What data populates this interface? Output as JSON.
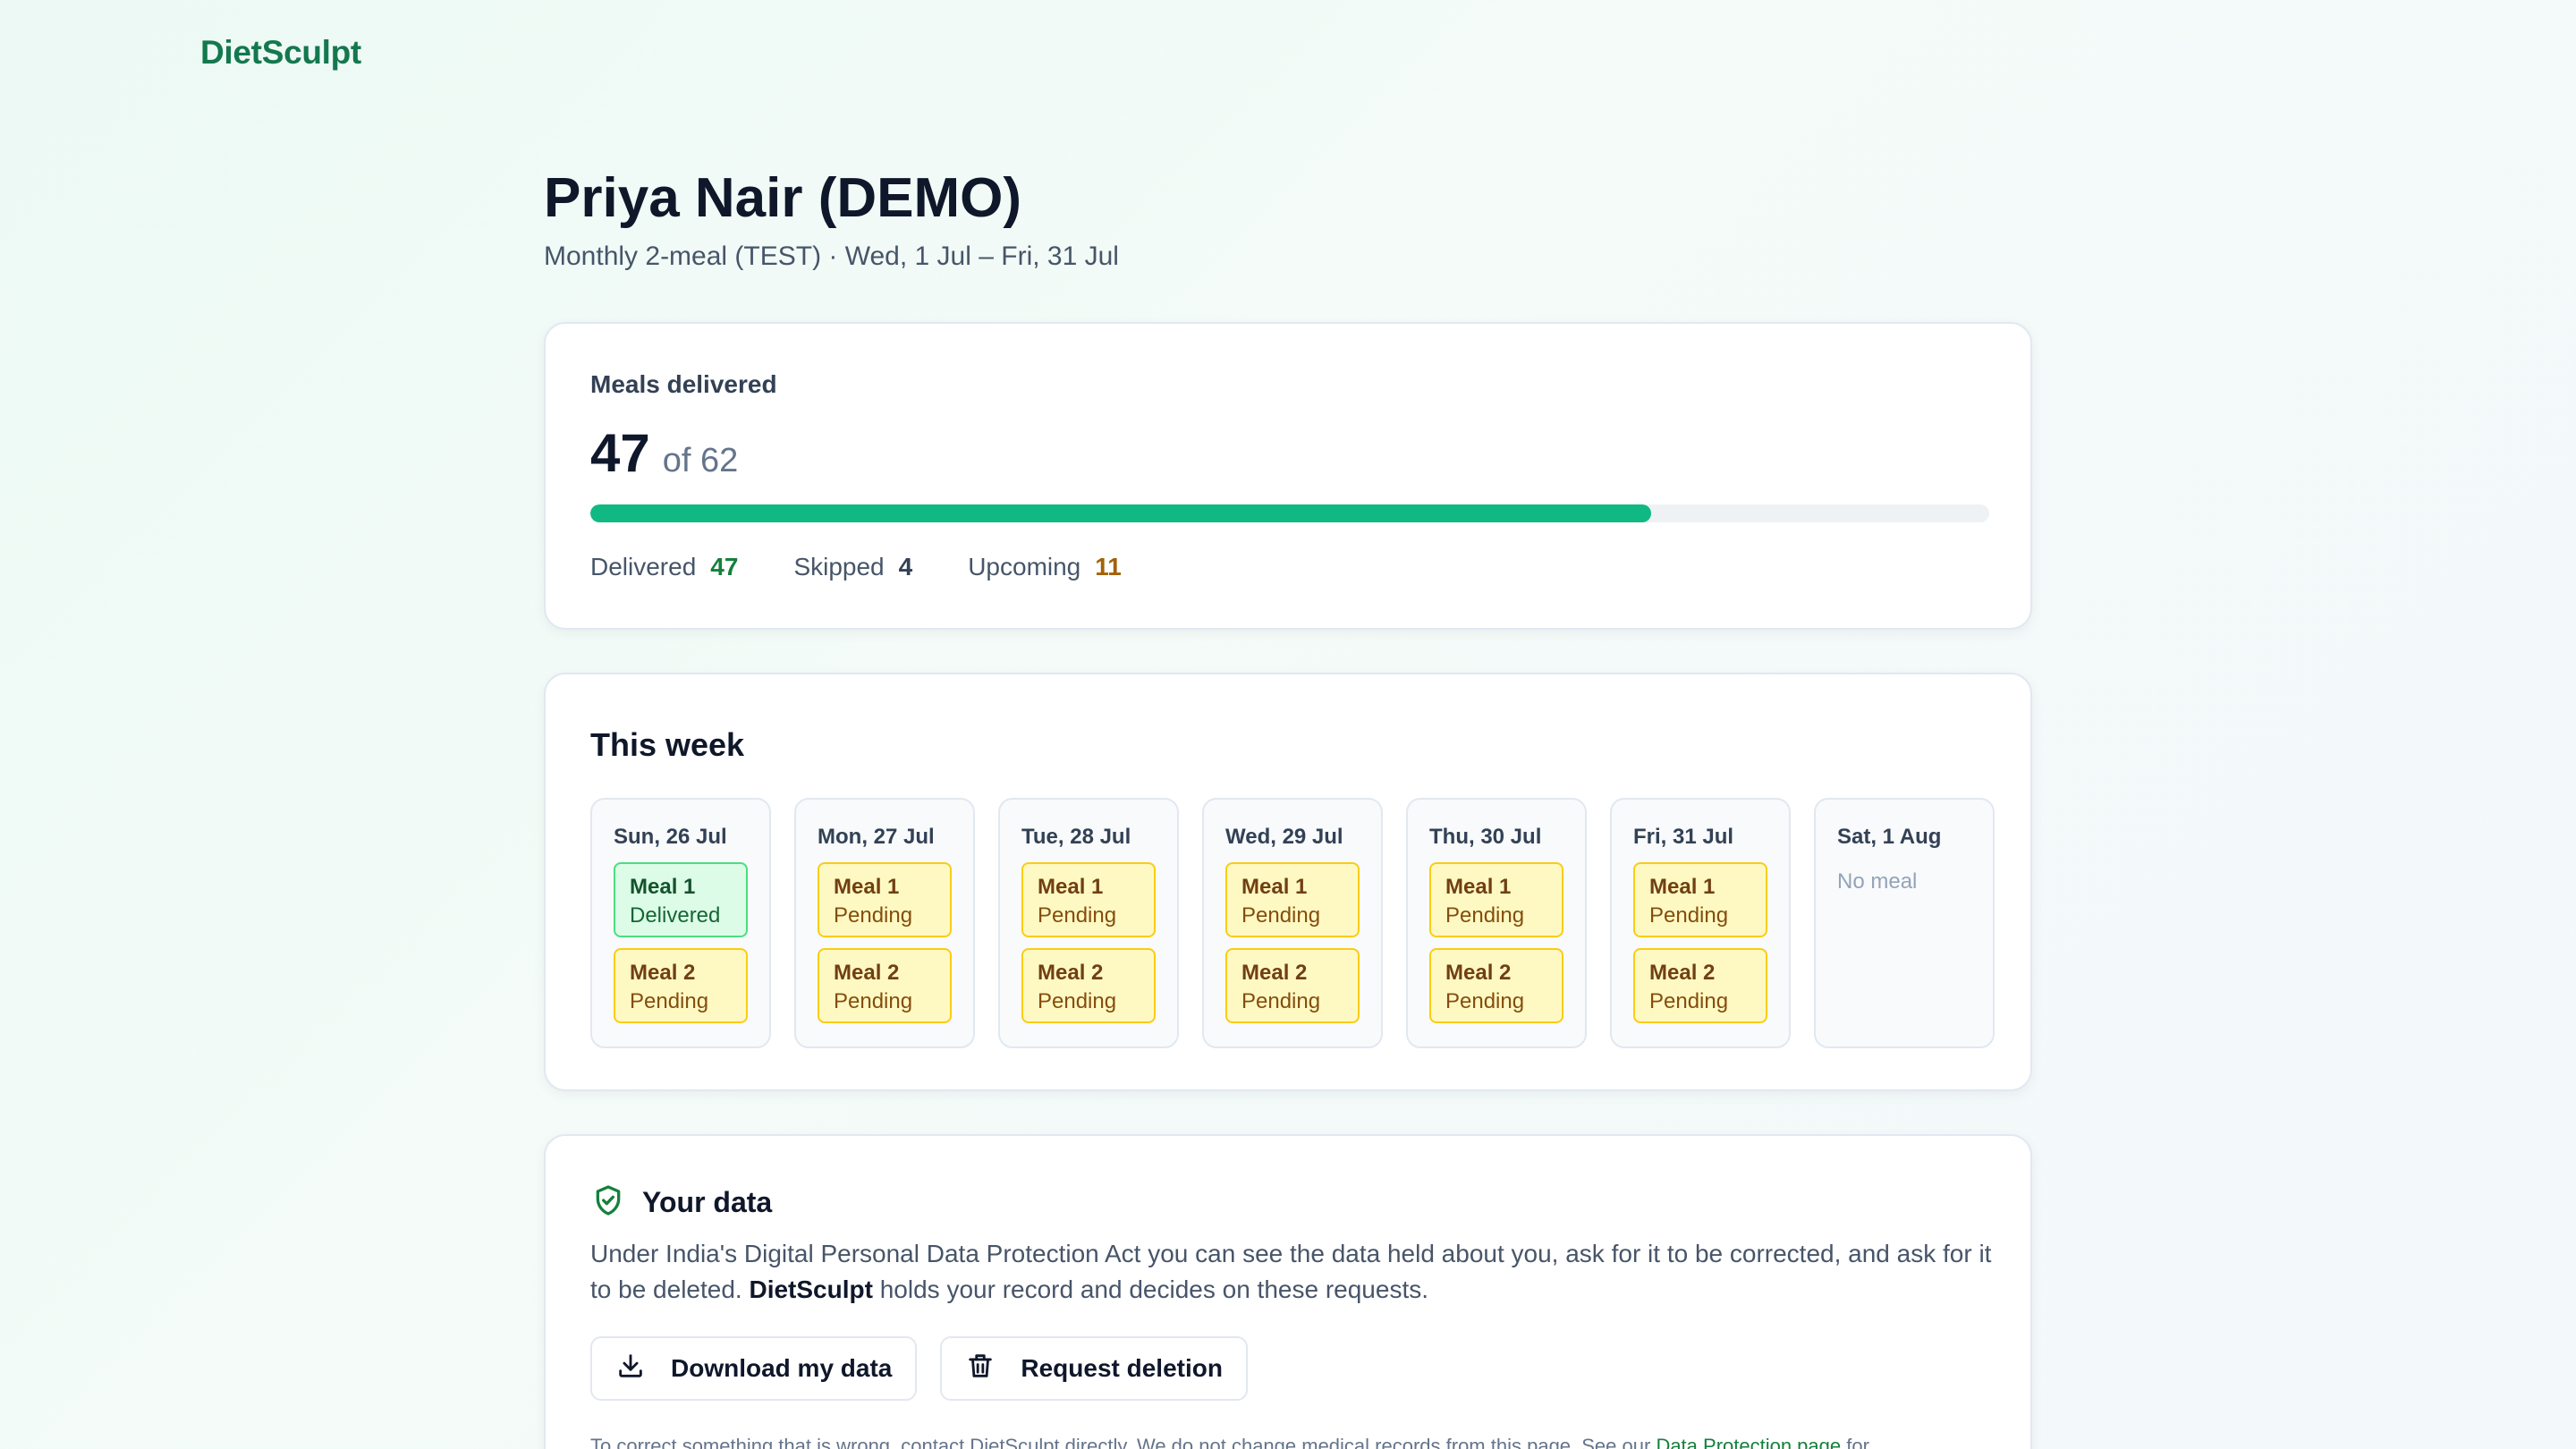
{
  "brand": "DietSculpt",
  "header": {
    "title": "Priya Nair (DEMO)",
    "subtitle": "Monthly 2-meal (TEST) · Wed, 1 Jul – Fri, 31 Jul"
  },
  "progress": {
    "label": "Meals delivered",
    "delivered": "47",
    "of_text": "of 62",
    "fraction": 0.7581,
    "stats": [
      {
        "label": "Delivered",
        "value": "47"
      },
      {
        "label": "Skipped",
        "value": "4"
      },
      {
        "label": "Upcoming",
        "value": "11"
      }
    ]
  },
  "week": {
    "title": "This week",
    "days": [
      {
        "label": "Sun, 26 Jul",
        "meals": [
          {
            "name": "Meal 1",
            "status": "Delivered"
          },
          {
            "name": "Meal 2",
            "status": "Pending"
          }
        ]
      },
      {
        "label": "Mon, 27 Jul",
        "meals": [
          {
            "name": "Meal 1",
            "status": "Pending"
          },
          {
            "name": "Meal 2",
            "status": "Pending"
          }
        ]
      },
      {
        "label": "Tue, 28 Jul",
        "meals": [
          {
            "name": "Meal 1",
            "status": "Pending"
          },
          {
            "name": "Meal 2",
            "status": "Pending"
          }
        ]
      },
      {
        "label": "Wed, 29 Jul",
        "meals": [
          {
            "name": "Meal 1",
            "status": "Pending"
          },
          {
            "name": "Meal 2",
            "status": "Pending"
          }
        ]
      },
      {
        "label": "Thu, 30 Jul",
        "meals": [
          {
            "name": "Meal 1",
            "status": "Pending"
          },
          {
            "name": "Meal 2",
            "status": "Pending"
          }
        ]
      },
      {
        "label": "Fri, 31 Jul",
        "meals": [
          {
            "name": "Meal 1",
            "status": "Pending"
          },
          {
            "name": "Meal 2",
            "status": "Pending"
          }
        ]
      },
      {
        "label": "Sat, 1 Aug",
        "meals": [],
        "empty_text": "No meal"
      }
    ]
  },
  "data_section": {
    "icon": "shield-check-icon",
    "title": "Your data",
    "text_before": "Under India's Digital Personal Data Protection Act you can see the data held about you, ask for it to be corrected, and ask for it to be deleted. ",
    "text_bold": "DietSculpt",
    "text_after": " holds your record and decides on these requests.",
    "download_label": "Download my data",
    "delete_label": "Request deletion",
    "footnote": "To correct something that is wrong, contact DietSculpt directly. We do not change medical records from this page. See our ",
    "footnote_link": "Data Protection page",
    "footnote_after": " for"
  },
  "colors": {
    "brand": "#14784e",
    "progress": "#10b981",
    "delivered_bg": "#dcfce7",
    "pending_bg": "#fef9c3"
  }
}
